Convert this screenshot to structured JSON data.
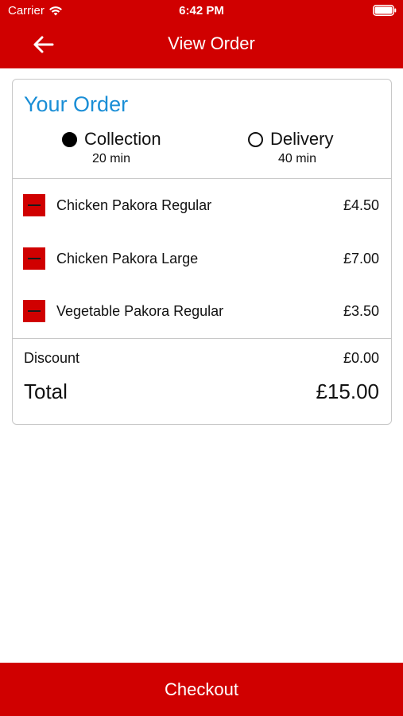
{
  "status_bar": {
    "carrier": "Carrier",
    "time": "6:42 PM"
  },
  "nav": {
    "title": "View Order",
    "back_icon": "arrow-left-icon"
  },
  "order": {
    "title": "Your Order",
    "options": [
      {
        "label": "Collection",
        "time": "20 min",
        "selected": true
      },
      {
        "label": "Delivery",
        "time": "40 min",
        "selected": false
      }
    ],
    "items": [
      {
        "name": "Chicken Pakora Regular",
        "price": "£4.50"
      },
      {
        "name": "Chicken Pakora Large",
        "price": "£7.00"
      },
      {
        "name": "Vegetable Pakora Regular",
        "price": "£3.50"
      }
    ],
    "discount_label": "Discount",
    "discount_value": "£0.00",
    "total_label": "Total",
    "total_value": "£15.00"
  },
  "checkout": {
    "label": "Checkout"
  },
  "colors": {
    "brand_red": "#d00000",
    "title_blue": "#1a8ed6"
  }
}
